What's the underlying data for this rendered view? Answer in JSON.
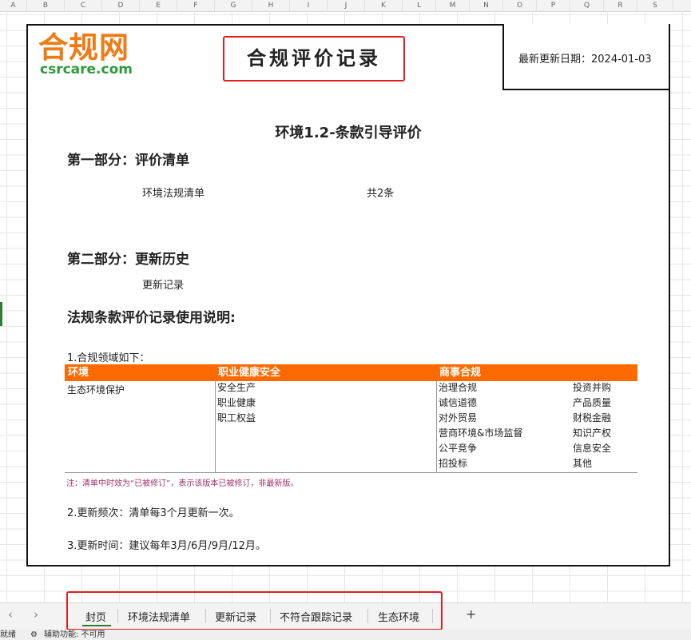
{
  "columns": [
    "A",
    "B",
    "C",
    "D",
    "E",
    "F",
    "G",
    "H",
    "I",
    "J",
    "K",
    "L",
    "M",
    "N",
    "O",
    "P",
    "Q",
    "R",
    "S"
  ],
  "logo": {
    "cn": "合规网",
    "en": "csrcare.com"
  },
  "title": "合规评价记录",
  "update_date_label": "最新更新日期：2024-01-03",
  "subtitle": "环境1.2-条款引导评价",
  "part1": {
    "heading": "第一部分：评价清单",
    "item": "环境法规清单",
    "count": "共2条"
  },
  "part2": {
    "heading": "第二部分：更新历史",
    "item": "更新记录"
  },
  "usage_heading": "法规条款评价记录使用说明:",
  "point1": "1.合规领域如下：",
  "domains": {
    "env": {
      "header": "环境",
      "items": [
        "生态环境保护"
      ]
    },
    "ohs": {
      "header": "职业健康安全",
      "items": [
        "安全生产",
        "职业健康",
        "职工权益"
      ]
    },
    "biz": {
      "header": "商事合规",
      "col1": [
        "治理合规",
        "诚信道德",
        "对外贸易",
        "营商环境&市场监督",
        "公平竞争",
        "招投标"
      ],
      "col2": [
        "投资并购",
        "产品质量",
        "财税金融",
        "知识产权",
        "信息安全",
        "其他"
      ]
    }
  },
  "note": "注：清单中时效为“已被修订”，表示该版本已被修订，非最新版。",
  "point2": "2.更新频次：清单每3个月更新一次。",
  "point3": "3.更新时间：建议每年3月/6月/9月/12月。",
  "tabs": [
    "封页",
    "环境法规清单",
    "更新记录",
    "不符合跟踪记录",
    "生态环境"
  ],
  "add_tab": "+",
  "nav": {
    "prev": "‹",
    "next": "›"
  },
  "status": {
    "left": "就绪",
    "accessibility": "辅助功能: 不可用"
  },
  "colors": {
    "accent": "#ff6a00",
    "logo_orange": "#f07a14",
    "logo_green": "#2e9a3a",
    "highlight_red": "#e02020",
    "note": "#a0306a"
  }
}
